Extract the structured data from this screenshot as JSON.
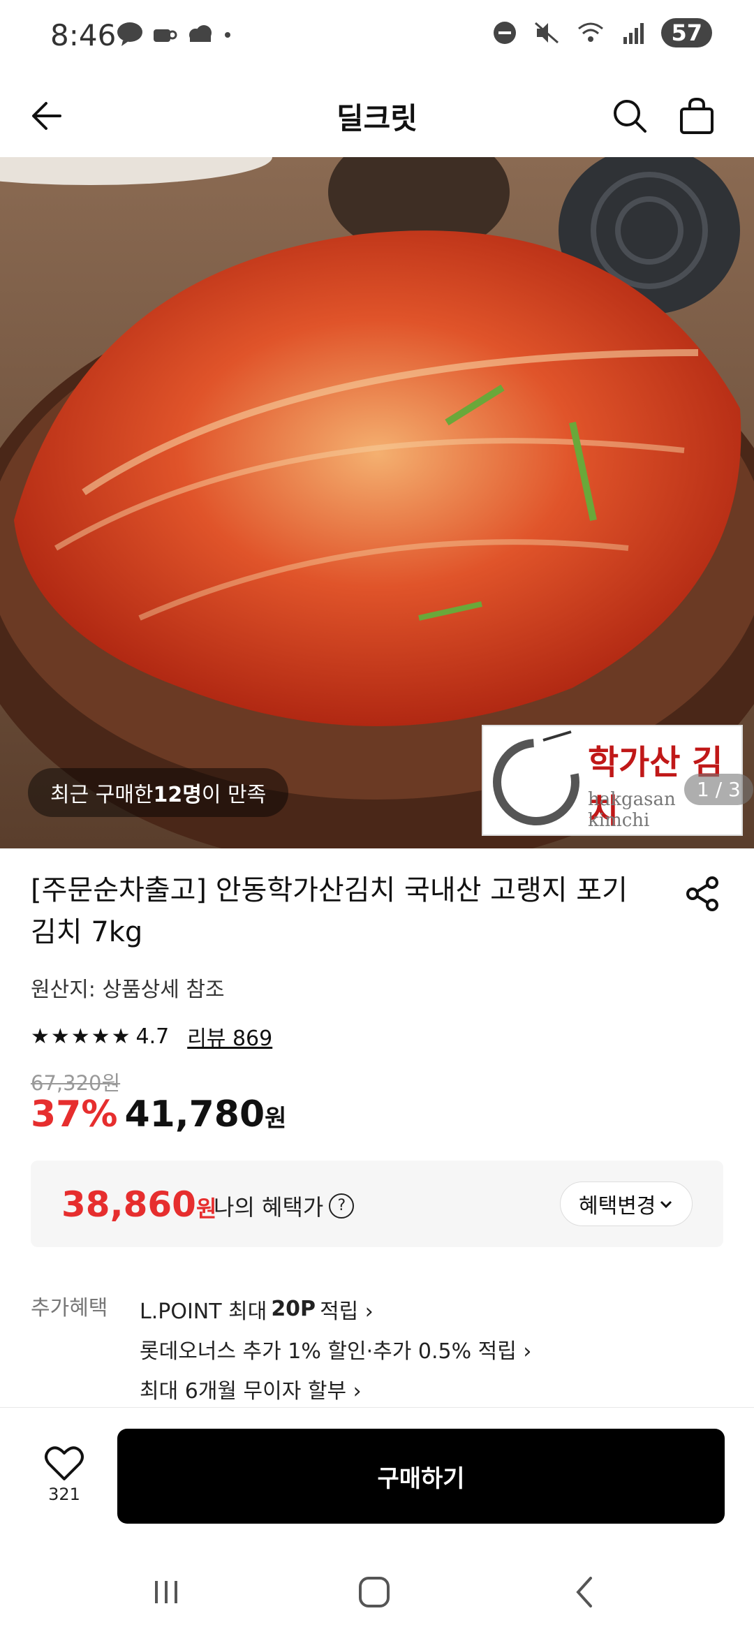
{
  "status_bar": {
    "time": "8:46",
    "battery": "57",
    "notification_icons": [
      "messenger-icon",
      "coffee-icon",
      "cloud-icon",
      "dot-icon"
    ],
    "system_icons": [
      "dnd-icon",
      "mute-icon",
      "wifi-icon",
      "signal-icon"
    ]
  },
  "header": {
    "title": "딜크릿"
  },
  "hero": {
    "buyers_prefix": "최근 구매한 ",
    "buyers_count": "12명",
    "buyers_suffix": "이 만족",
    "counter": "1 / 3",
    "logo_text_kr": "학가산 김치",
    "logo_text_en": "hakgasan kimchi"
  },
  "product": {
    "name": "[주문순차출고] 안동학가산김치 국내산 고랭지 포기김치 7kg",
    "origin": "원산지: 상품상세 참조",
    "rating_value": "4.7",
    "rating_stars": 4.7,
    "review_label": "리뷰 869",
    "original_price": "67,320원",
    "discount": "37%",
    "price": "41,780",
    "price_unit": "원"
  },
  "benefit": {
    "price": "38,860",
    "unit": "원",
    "label": "나의 혜택가",
    "change_button": "혜택변경"
  },
  "extra": {
    "label": "추가혜택",
    "items": [
      {
        "pre": "L.POINT 최대 ",
        "bold": "20P",
        "post": " 적립 ›"
      },
      {
        "pre": "롯데오너스 추가 1% 할인·추가 0.5% 적립 ›",
        "bold": "",
        "post": ""
      },
      {
        "pre": "최대 6개월 무이자 할부 ›",
        "bold": "",
        "post": ""
      }
    ]
  },
  "bottom": {
    "wish_count": "321",
    "buy_label": "구매하기"
  },
  "colors": {
    "accent_red": "#e62e2e",
    "buy_button": "#000000",
    "benefit_bg": "#f6f6f6"
  }
}
